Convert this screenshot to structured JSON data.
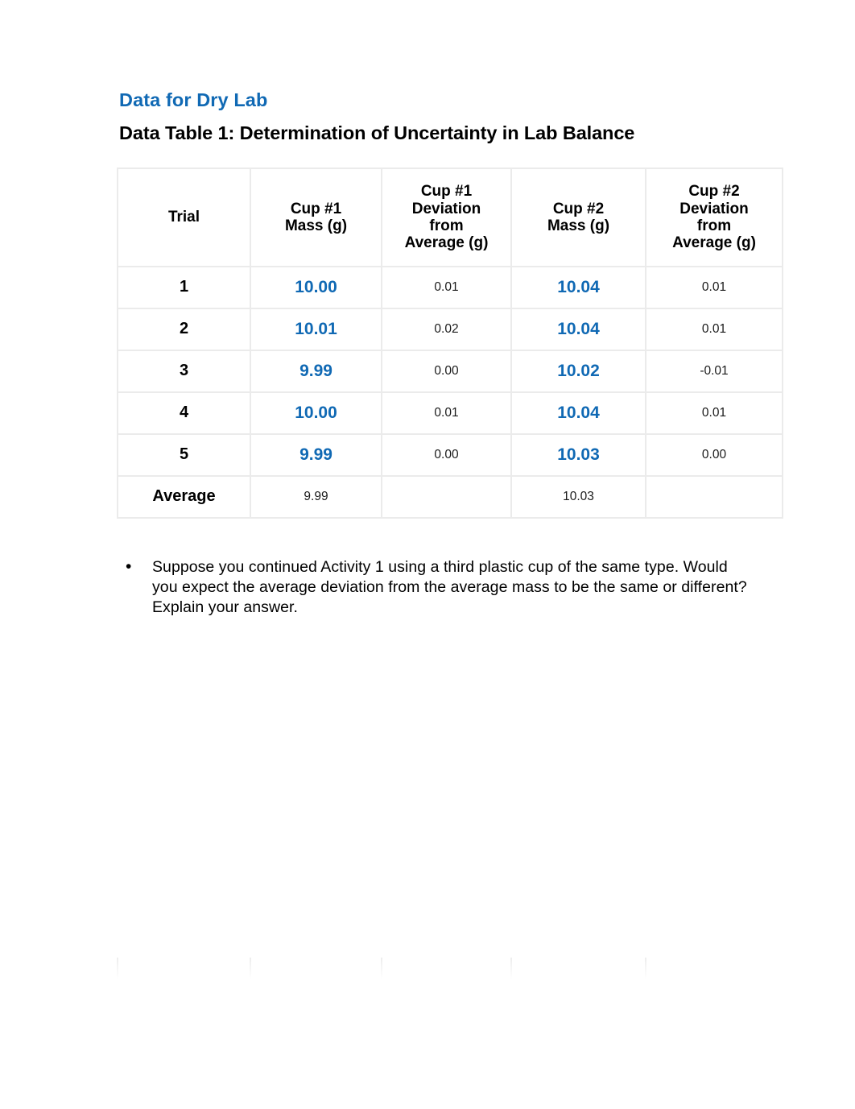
{
  "document": {
    "heading": "Data for Dry Lab",
    "table_title": "Data Table 1: Determination of Uncertainty in Lab Balance"
  },
  "colors": {
    "heading_blue": "#1069b4",
    "value_blue": "#1069b4",
    "grid_gray": "#ebebeb",
    "text_black": "#000000"
  },
  "table": {
    "headers": [
      "Trial",
      "Cup #1 Mass (g)",
      "Cup #1 Deviation from Average (g)",
      "Cup #2 Mass (g)",
      "Cup #2 Deviation from Average (g)"
    ],
    "headers_lines": {
      "trial": "Trial",
      "cup1_mass_l1": "Cup #1",
      "cup1_mass_l2": "Mass (g)",
      "cup1_dev_l1": "Cup #1",
      "cup1_dev_l2": "Deviation",
      "cup1_dev_l3": "from",
      "cup1_dev_l4": "Average (g)",
      "cup2_mass_l1": "Cup #2",
      "cup2_mass_l2": "Mass (g)",
      "cup2_dev_l1": "Cup #2",
      "cup2_dev_l2": "Deviation",
      "cup2_dev_l3": "from",
      "cup2_dev_l4": "Average (g)"
    },
    "rows": [
      {
        "trial": "1",
        "cup1_mass": "10.00",
        "cup1_dev": "0.01",
        "cup2_mass": "10.04",
        "cup2_dev": "0.01"
      },
      {
        "trial": "2",
        "cup1_mass": "10.01",
        "cup1_dev": "0.02",
        "cup2_mass": "10.04",
        "cup2_dev": "0.01"
      },
      {
        "trial": "3",
        "cup1_mass": "9.99",
        "cup1_dev": "0.00",
        "cup2_mass": "10.02",
        "cup2_dev": "-0.01"
      },
      {
        "trial": "4",
        "cup1_mass": "10.00",
        "cup1_dev": "0.01",
        "cup2_mass": "10.04",
        "cup2_dev": "0.01"
      },
      {
        "trial": "5",
        "cup1_mass": "9.99",
        "cup1_dev": "0.00",
        "cup2_mass": "10.03",
        "cup2_dev": "0.00"
      }
    ],
    "average_row": {
      "label": "Average",
      "cup1_mass": "9.99",
      "cup1_dev": "",
      "cup2_mass": "10.03",
      "cup2_dev": ""
    }
  },
  "bullet": {
    "marker": "•",
    "text": "Suppose you continued Activity 1 using a third plastic cup of the same type. Would you expect the average deviation from the average mass to be the same or different? Explain your answer."
  }
}
